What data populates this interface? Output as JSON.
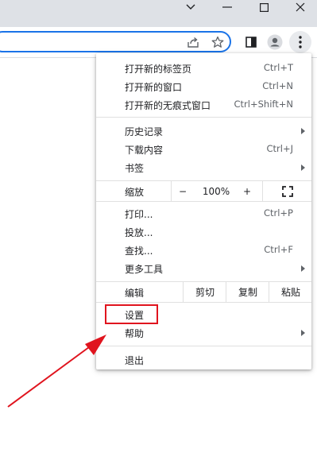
{
  "window": {
    "controls": [
      "chevron-down",
      "minimize",
      "maximize",
      "close"
    ]
  },
  "menu": {
    "new_tab": {
      "label": "打开新的标签页",
      "accel": "Ctrl+T"
    },
    "new_window": {
      "label": "打开新的窗口",
      "accel": "Ctrl+N"
    },
    "incognito": {
      "label": "打开新的无痕式窗口",
      "accel": "Ctrl+Shift+N"
    },
    "history": {
      "label": "历史记录"
    },
    "downloads": {
      "label": "下载内容",
      "accel": "Ctrl+J"
    },
    "bookmarks": {
      "label": "书签"
    },
    "zoom": {
      "label": "缩放",
      "minus": "−",
      "level": "100%",
      "plus": "+"
    },
    "print": {
      "label": "打印...",
      "accel": "Ctrl+P"
    },
    "cast": {
      "label": "投放..."
    },
    "find": {
      "label": "查找...",
      "accel": "Ctrl+F"
    },
    "more_tools": {
      "label": "更多工具"
    },
    "edit": {
      "label": "编辑",
      "cut": "剪切",
      "copy": "复制",
      "paste": "粘贴"
    },
    "settings": {
      "label": "设置"
    },
    "help": {
      "label": "帮助"
    },
    "exit": {
      "label": "退出"
    }
  },
  "colors": {
    "accent": "#1a73e8",
    "highlight_box": "#e0141e",
    "arrow": "#e0141e"
  }
}
